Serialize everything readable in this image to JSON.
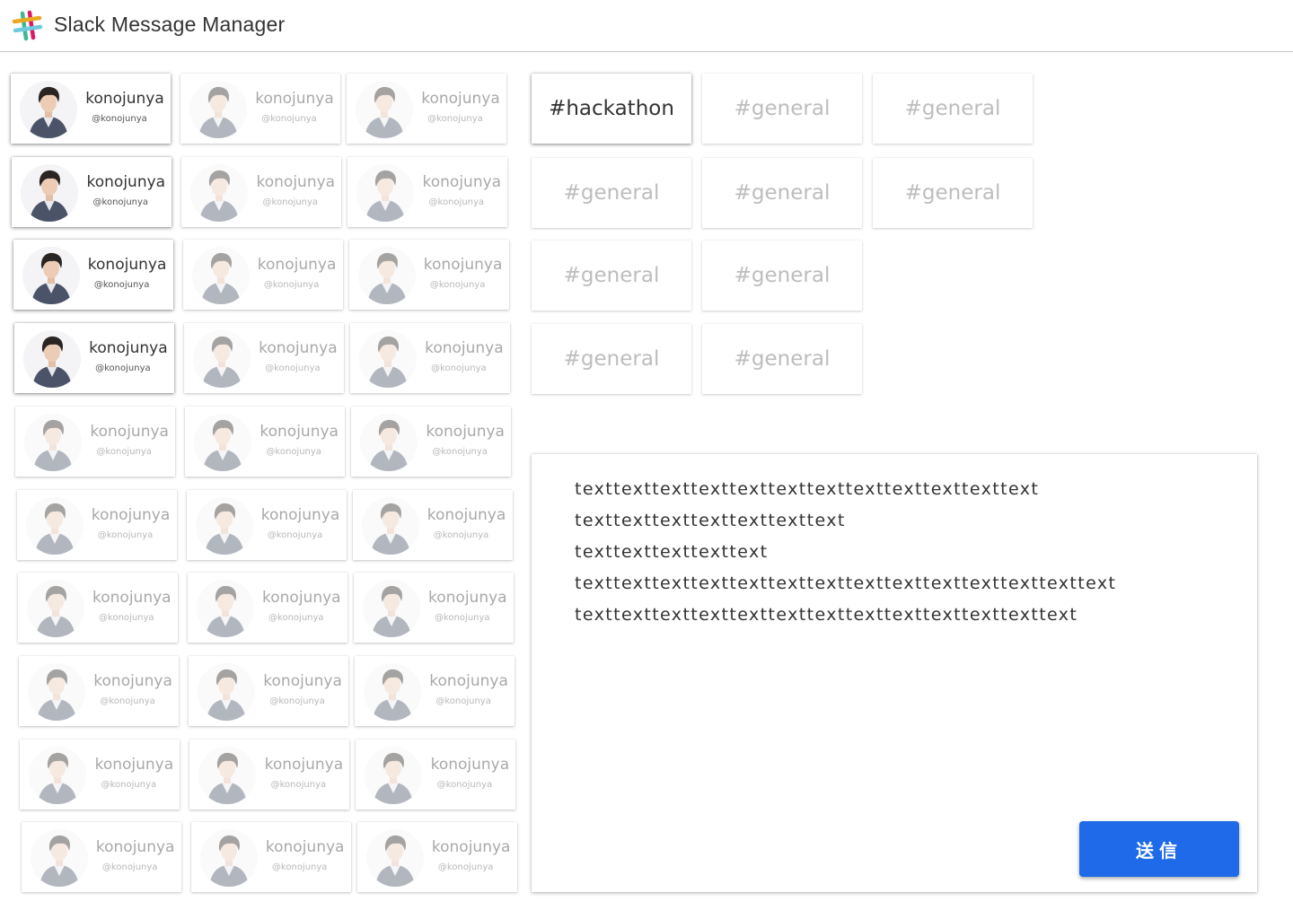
{
  "app": {
    "title": "Slack Message Manager",
    "logo_icon": "slack-logo-icon"
  },
  "users": [
    [
      {
        "name": "konojunya",
        "handle": "@konojunya",
        "selected": true
      },
      {
        "name": "konojunya",
        "handle": "@konojunya",
        "selected": false
      },
      {
        "name": "konojunya",
        "handle": "@konojunya",
        "selected": false
      }
    ],
    [
      {
        "name": "konojunya",
        "handle": "@konojunya",
        "selected": true
      },
      {
        "name": "konojunya",
        "handle": "@konojunya",
        "selected": false
      },
      {
        "name": "konojunya",
        "handle": "@konojunya",
        "selected": false
      }
    ],
    [
      {
        "name": "konojunya",
        "handle": "@konojunya",
        "selected": true
      },
      {
        "name": "konojunya",
        "handle": "@konojunya",
        "selected": false
      },
      {
        "name": "konojunya",
        "handle": "@konojunya",
        "selected": false
      }
    ],
    [
      {
        "name": "konojunya",
        "handle": "@konojunya",
        "selected": true
      },
      {
        "name": "konojunya",
        "handle": "@konojunya",
        "selected": false
      },
      {
        "name": "konojunya",
        "handle": "@konojunya",
        "selected": false
      }
    ],
    [
      {
        "name": "konojunya",
        "handle": "@konojunya",
        "selected": false
      },
      {
        "name": "konojunya",
        "handle": "@konojunya",
        "selected": false
      },
      {
        "name": "konojunya",
        "handle": "@konojunya",
        "selected": false
      }
    ],
    [
      {
        "name": "konojunya",
        "handle": "@konojunya",
        "selected": false
      },
      {
        "name": "konojunya",
        "handle": "@konojunya",
        "selected": false
      },
      {
        "name": "konojunya",
        "handle": "@konojunya",
        "selected": false
      }
    ],
    [
      {
        "name": "konojunya",
        "handle": "@konojunya",
        "selected": false
      },
      {
        "name": "konojunya",
        "handle": "@konojunya",
        "selected": false
      },
      {
        "name": "konojunya",
        "handle": "@konojunya",
        "selected": false
      }
    ],
    [
      {
        "name": "konojunya",
        "handle": "@konojunya",
        "selected": false
      },
      {
        "name": "konojunya",
        "handle": "@konojunya",
        "selected": false
      },
      {
        "name": "konojunya",
        "handle": "@konojunya",
        "selected": false
      }
    ],
    [
      {
        "name": "konojunya",
        "handle": "@konojunya",
        "selected": false
      },
      {
        "name": "konojunya",
        "handle": "@konojunya",
        "selected": false
      },
      {
        "name": "konojunya",
        "handle": "@konojunya",
        "selected": false
      }
    ],
    [
      {
        "name": "konojunya",
        "handle": "@konojunya",
        "selected": false
      },
      {
        "name": "konojunya",
        "handle": "@konojunya",
        "selected": false
      },
      {
        "name": "konojunya",
        "handle": "@konojunya",
        "selected": false
      }
    ]
  ],
  "channels": [
    [
      {
        "label": "#hackathon",
        "selected": true
      },
      {
        "label": "#general",
        "selected": false
      },
      {
        "label": "#general",
        "selected": false
      }
    ],
    [
      {
        "label": "#general",
        "selected": false
      },
      {
        "label": "#general",
        "selected": false
      },
      {
        "label": "#general",
        "selected": false
      }
    ],
    [
      {
        "label": "#general",
        "selected": false
      },
      {
        "label": "#general",
        "selected": false
      }
    ],
    [
      {
        "label": "#general",
        "selected": false
      },
      {
        "label": "#general",
        "selected": false
      }
    ]
  ],
  "composer": {
    "message": "texttexttexttexttexttexttexttexttexttexttexttext\ntexttexttexttexttexttexttext\ntexttexttexttexttext\ntexttexttexttexttexttexttexttexttexttexttexttexttexttext\ntexttexttexttexttexttexttexttexttexttexttexttexttext",
    "send_label": "送信"
  },
  "colors": {
    "send_button": "#1e6ae8",
    "header_border": "#c8c8c8",
    "dim_text": "#bdbdbd"
  }
}
